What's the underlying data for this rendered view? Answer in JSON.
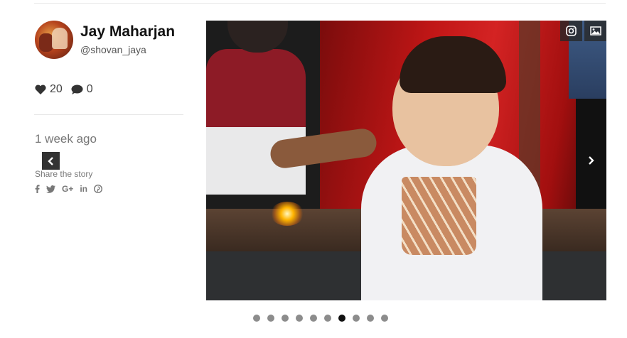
{
  "user": {
    "name": "Jay Maharjan",
    "handle": "@shovan_jaya"
  },
  "stats": {
    "likes": "20",
    "comments": "0"
  },
  "post": {
    "time_ago": "1 week ago"
  },
  "share": {
    "title": "Share the story",
    "icons": [
      "facebook-icon",
      "twitter-icon",
      "google-plus-icon",
      "linkedin-icon",
      "pinterest-icon"
    ],
    "google_plus_label": "G+",
    "linkedin_label": "in"
  },
  "carousel": {
    "dot_count": 10,
    "active_index": 6
  },
  "colors": {
    "dot": "#8c8c8c",
    "dot_active": "#111111",
    "button_bg": "#333333"
  }
}
